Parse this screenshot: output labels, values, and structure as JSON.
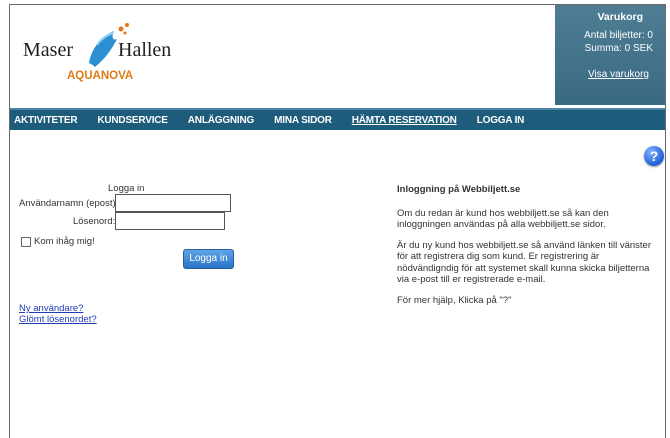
{
  "header": {
    "logo": {
      "line1": "Maser",
      "line2": "Hallen",
      "line3": "AQUANOVA"
    },
    "cart": {
      "title": "Varukorg",
      "tickets_label": "Antal biljetter: 0",
      "sum_label": "Summa: 0 SEK",
      "view_link": "Visa varukorg"
    }
  },
  "nav": {
    "items": [
      {
        "label": "AKTIVITETER"
      },
      {
        "label": "KUNDSERVICE"
      },
      {
        "label": "ANLÄGGNING"
      },
      {
        "label": "MINA SIDOR"
      },
      {
        "label": "HÄMTA RESERVATION"
      },
      {
        "label": "LOGGA IN"
      }
    ]
  },
  "help_icon": "?",
  "login": {
    "heading": "Logga in",
    "username_label": "Användarnamn (epost):",
    "username_value": "",
    "password_label": "Lösenord:",
    "password_value": "",
    "remember_label": "Kom ihåg mig!",
    "submit_label": "Logga in",
    "new_user_link": "Ny användare?",
    "forgot_link": "Glömt lösenordet?"
  },
  "info": {
    "title": "Inloggning på Webbiljett.se",
    "p1": "Om du redan är kund hos webbiljett.se så kan den inloggningen användas på alla webbiljett.se sidor.",
    "p2": "Är du ny kund hos webbiljett.se så använd länken till vänster för att registrera dig som kund. Er registrering är nödvändigndig för att systemet skall kunna skicka biljetterna via e-post till er registrerade e-mail.",
    "p3": "För mer hjälp, Klicka på \"?\""
  },
  "colors": {
    "nav_bg": "#1e5c7b",
    "cart_bg": "#3a6a82",
    "link": "#1f3bb3",
    "button": "#2a72c7",
    "logo_orange": "#e07a16",
    "logo_blue": "#2b8fd1"
  }
}
